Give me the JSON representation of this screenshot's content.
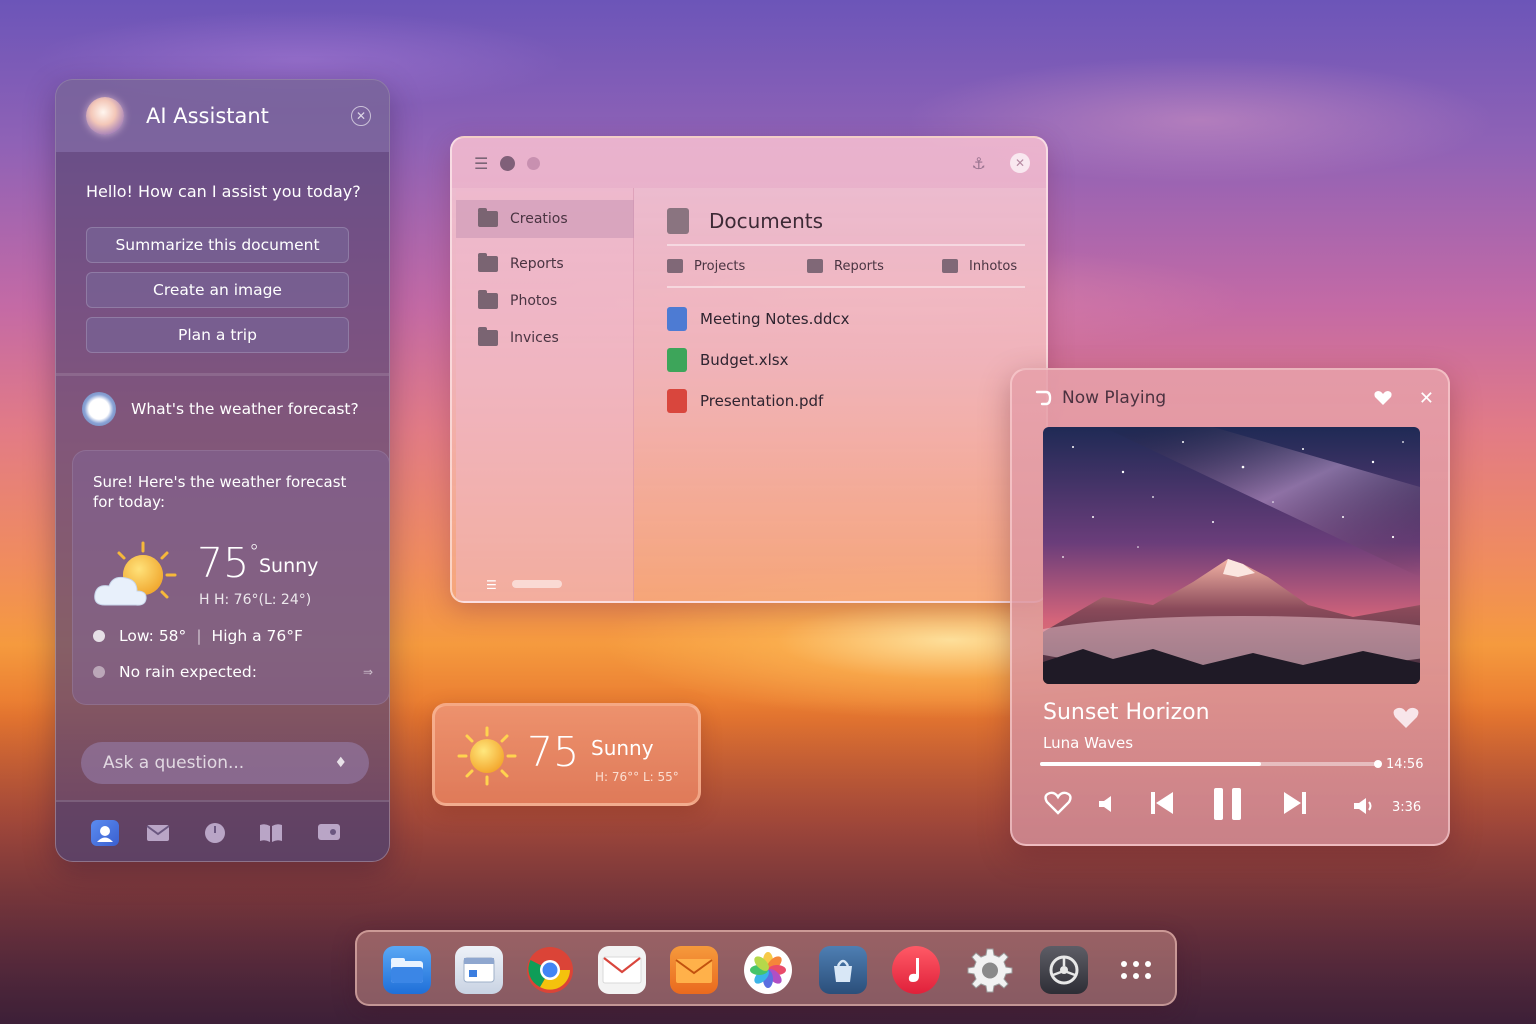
{
  "assistant": {
    "title": "AI Assistant",
    "greeting": "Hello! How can I assist you today?",
    "suggestions": [
      "Summarize this document",
      "Create an image",
      "Plan a trip"
    ],
    "user_question": "What's the weather forecast?",
    "reply_text": "Sure! Here's the weather forecast for today:",
    "forecast": {
      "temp": "75",
      "deg": "°",
      "condition": "Sunny",
      "hilo": "H H: 76°(L: 24°)",
      "low_text": "Low: 58°",
      "sep": "|",
      "high_text": "High a 76°F",
      "rain": "No rain expected:"
    },
    "input_placeholder": "Ask a question...",
    "footer_icons": [
      "assistant-app-icon",
      "mail-icon",
      "clock-icon",
      "book-icon",
      "chat-icon"
    ]
  },
  "explorer": {
    "sidebar": [
      "Creatios",
      "Reports",
      "Photos",
      "Invices"
    ],
    "title": "Documents",
    "breadcrumbs": [
      "Projects",
      "Reports",
      "Inhotos"
    ],
    "files": [
      {
        "name": "Meeting Notes.ddcx",
        "color": "#4d7bd3"
      },
      {
        "name": "Budget.xlsx",
        "color": "#3da55a"
      },
      {
        "name": "Presentation.pdf",
        "color": "#d9463d"
      }
    ]
  },
  "weather_widget": {
    "temp": "75",
    "condition": "Sunny",
    "hilo": "H: 76°° L: 55°"
  },
  "player": {
    "label": "Now Playing",
    "song": "Sunset Horizon",
    "artist": "Luna Waves",
    "time_total": "14:56",
    "time_elapsed": "3:36",
    "progress": 0.65
  },
  "dock": {
    "apps": [
      "files-icon",
      "finder-icon",
      "chrome-icon",
      "mail-icon",
      "mailbox-icon",
      "photos-icon",
      "app-store-icon",
      "music-icon",
      "settings-icon",
      "system-prefs-icon",
      "more-apps-icon"
    ]
  },
  "colors": {
    "accent": "#8a6aa8",
    "sun": "#f7c948"
  }
}
